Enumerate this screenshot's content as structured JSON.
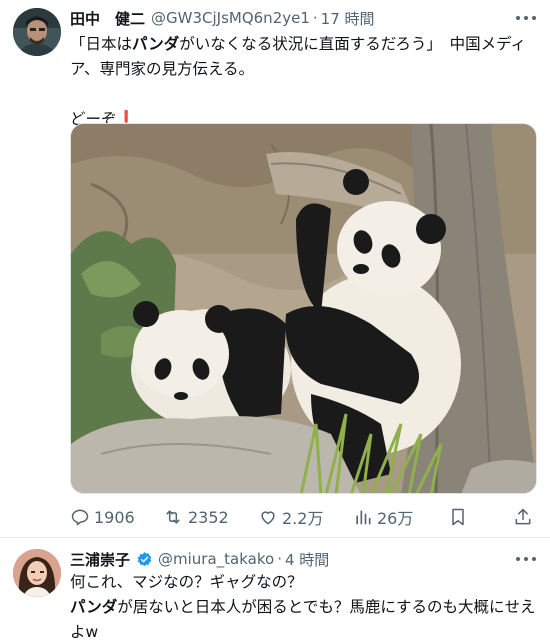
{
  "tweet1": {
    "author_name": "田中　健二",
    "handle": "@GW3CjJsMQ6n2ye1",
    "separator": "·",
    "time": "17 時間",
    "text_line1_a": "「日本は",
    "text_line1_bold": "パンダ",
    "text_line1_b": "がいなくなる状況に直面するだろう」　中国メディ",
    "text_line2": "ア、専門家の見方伝える。",
    "text_line3": "どーぞ",
    "emoji": "❗",
    "stats": {
      "replies": "1906",
      "retweets": "2352",
      "likes": "2.2万",
      "views": "26万"
    }
  },
  "tweet2": {
    "author_name": "三浦崇子",
    "handle": "@miura_takako",
    "separator": "·",
    "time": "4 時間",
    "text_line1": "何これ、マジなの？ギャグなの？",
    "text_bold": "パンダ",
    "text_rest": "が居ないと日本人が困るとでも？馬鹿にするのも大概にせえよw"
  },
  "colors": {
    "text_primary": "#0f1419",
    "text_secondary": "#536471",
    "verified_blue": "#1d9bf0",
    "exclamation_red": "#e0243c"
  },
  "icons": [
    "more-icon",
    "verified-icon",
    "reply-icon",
    "retweet-icon",
    "like-icon",
    "views-icon",
    "bookmark-icon",
    "share-icon"
  ]
}
